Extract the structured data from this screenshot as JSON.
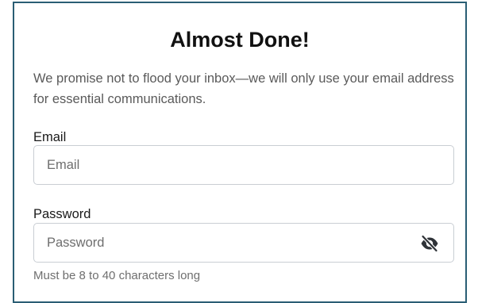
{
  "form": {
    "title": "Almost Done!",
    "subtitle": "We promise not to flood your inbox—we will only use your email address for essential communications.",
    "email": {
      "label": "Email",
      "placeholder": "Email",
      "value": ""
    },
    "password": {
      "label": "Password",
      "placeholder": "Password",
      "value": "",
      "toggle_icon": "eye-slash-icon",
      "hint": "Must be 8 to 40 characters long"
    }
  },
  "colors": {
    "card_border": "#2a5e74",
    "input_border": "#c9ced3",
    "hint_text": "#6f6f6f"
  }
}
